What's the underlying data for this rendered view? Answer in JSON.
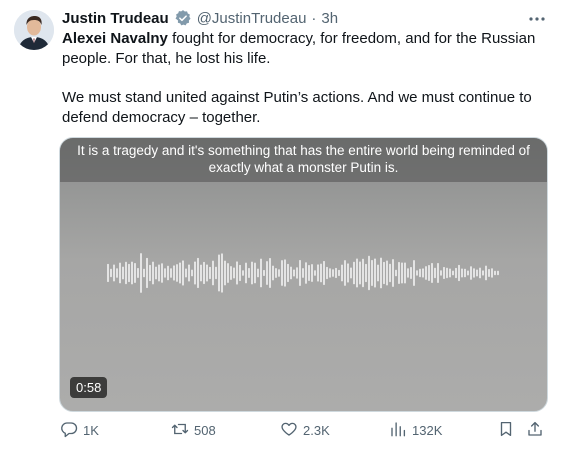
{
  "tweet": {
    "author_name": "Justin Trudeau",
    "handle": "@JustinTrudeau",
    "separator": "·",
    "time": "3h",
    "more_label": "···",
    "text_bold": "Alexei Navalny",
    "text_line1_rest": " fought for democracy, for freedom, and for the Russian people. For that, he lost his life.",
    "text_para2": "We must stand united against Putin’s actions. And we must continue to defend democracy – together."
  },
  "media": {
    "caption": "It is a tragedy and it's something that has the entire world being reminded of exactly what a monster Putin is.",
    "duration": "0:58"
  },
  "actions": {
    "replies": "1K",
    "reposts": "508",
    "likes": "2.3K",
    "views": "132K"
  },
  "colors": {
    "text": "#0f1419",
    "secondary": "#536471",
    "verified_badge": "#829aab"
  },
  "icons": [
    "verified-badge-icon",
    "more-icon",
    "reply-icon",
    "repost-icon",
    "like-icon",
    "views-icon",
    "bookmark-icon",
    "share-icon"
  ]
}
